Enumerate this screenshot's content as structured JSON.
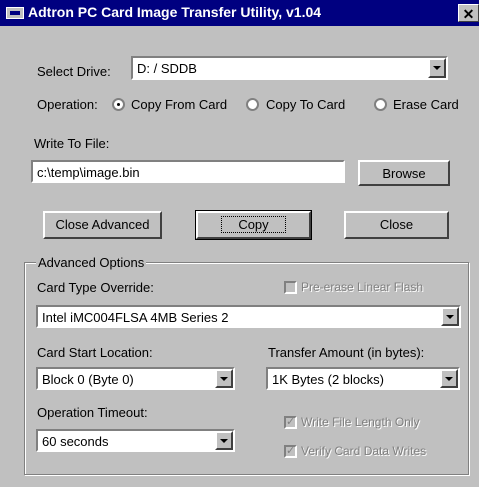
{
  "window": {
    "title": "Adtron PC Card Image Transfer Utility, v1.04",
    "close": "✕"
  },
  "drive": {
    "label": "Select Drive:",
    "value": "D: / SDDB"
  },
  "operation": {
    "label": "Operation:",
    "options": [
      "Copy From Card",
      "Copy To Card",
      "Erase Card"
    ],
    "selected": "Copy From Card"
  },
  "file": {
    "label": "Write To File:",
    "value": "c:\\temp\\image.bin",
    "browse": "Browse"
  },
  "buttons": {
    "close_advanced": "Close Advanced",
    "copy": "Copy",
    "close": "Close"
  },
  "advanced": {
    "title": "Advanced Options",
    "card_type_label": "Card Type Override:",
    "card_type_value": "Intel iMC004FLSA 4MB Series 2",
    "pre_erase": {
      "label": "Pre-erase Linear Flash",
      "checked": false,
      "enabled": false
    },
    "start_label": "Card Start Location:",
    "start_value": "Block 0 (Byte 0)",
    "amount_label": "Transfer Amount (in bytes):",
    "amount_value": "1K Bytes (2 blocks)",
    "timeout_label": "Operation Timeout:",
    "timeout_value": "60 seconds",
    "write_len_only": {
      "label": "Write File Length Only",
      "checked": true,
      "enabled": false
    },
    "verify_writes": {
      "label": "Verify Card Data Writes",
      "checked": true,
      "enabled": false
    }
  }
}
